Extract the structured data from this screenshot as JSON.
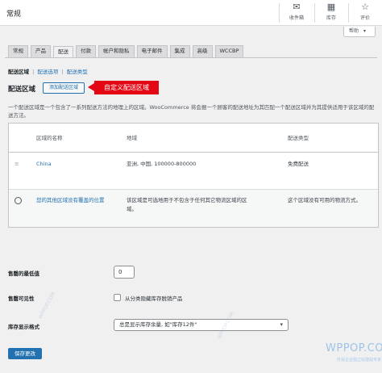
{
  "header": {
    "title": "常规",
    "icons": [
      {
        "name": "inbox-icon",
        "glyph": "✉",
        "label": "收件箱"
      },
      {
        "name": "inventory-icon",
        "glyph": "▦",
        "label": "库存"
      },
      {
        "name": "review-icon",
        "glyph": "☆",
        "label": "评价"
      }
    ]
  },
  "help": {
    "label": "帮助"
  },
  "tabs": [
    "常规",
    "产品",
    "配送",
    "付款",
    "帐户和隐私",
    "电子邮件",
    "集成",
    "高级",
    "WCCBP"
  ],
  "active_tab": "配送",
  "sublinks": {
    "items": [
      "配送区域",
      "配送选项",
      "配送类型"
    ],
    "separators": [
      "|",
      "|"
    ]
  },
  "zones": {
    "heading": "配送区域",
    "add_button": "添加配送区域",
    "callout": "自定义配送区域",
    "description": "一个配送区域是一个包含了一系列配送方法的地理上的区域。WooCommerce 将会据一个顾客的配送地址为其匹配一个配送区域并为其提供适用于该区域的配送方法。",
    "columns": {
      "name": "区域的名称",
      "region": "地域",
      "method": "配送类型"
    },
    "rows": [
      {
        "name": "China",
        "region": "亚洲, 中国, 100000-800000",
        "method": "免费配送"
      }
    ],
    "rest": {
      "name": "您的其他区域没有覆盖的位置",
      "region": "该区域是可选地用于不包含于任何其它物流区域的区域。",
      "method": "这个区域没有可用的物流方式。"
    }
  },
  "inventory": {
    "min_label": "售罄的最低值",
    "min_value": "0",
    "visibility_label": "售罄可见性",
    "visibility_checkbox": "从分类隐藏库存脱销产品",
    "display_label": "库存显示格式",
    "display_value": "总是显示库存余量, 如\"库存12件\""
  },
  "save_button": "保存更改",
  "watermark": {
    "brand": "WPPOP.COM",
    "tagline": "外贸企业独立站建站专家",
    "diag": "WPPOP.COM"
  }
}
